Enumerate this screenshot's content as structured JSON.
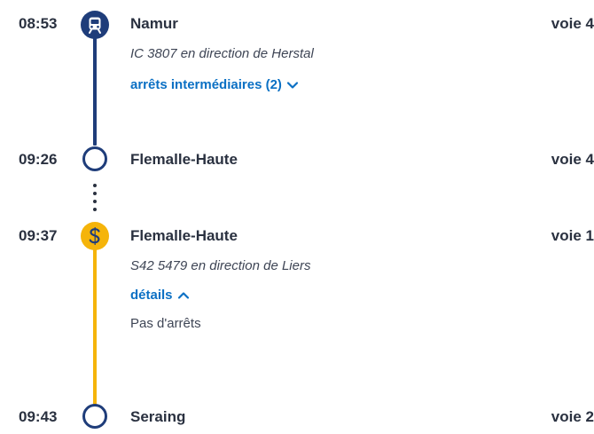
{
  "colors": {
    "train_line": "#1f3d7a",
    "s_line": "#f5b40a",
    "link": "#0b70c4",
    "text": "#2a3140"
  },
  "stops": [
    {
      "time": "08:53",
      "station": "Namur",
      "track": "voie 4",
      "icon": "train-icon",
      "service": "IC 3807 en direction de Herstal",
      "link_label": "arrêts intermédiaires (2)",
      "link_icon": "chevron-down-icon"
    },
    {
      "time": "09:26",
      "station": "Flemalle-Haute",
      "track": "voie 4",
      "icon": "stop-circle-icon"
    },
    {
      "time": "09:37",
      "station": "Flemalle-Haute",
      "track": "voie 1",
      "icon": "s-train-icon",
      "service": "S42 5479 en direction de Liers",
      "link_label": "détails",
      "link_icon": "chevron-up-icon",
      "details_text": "Pas d'arrêts"
    },
    {
      "time": "09:43",
      "station": "Seraing",
      "track": "voie 2",
      "icon": "stop-circle-icon"
    }
  ]
}
